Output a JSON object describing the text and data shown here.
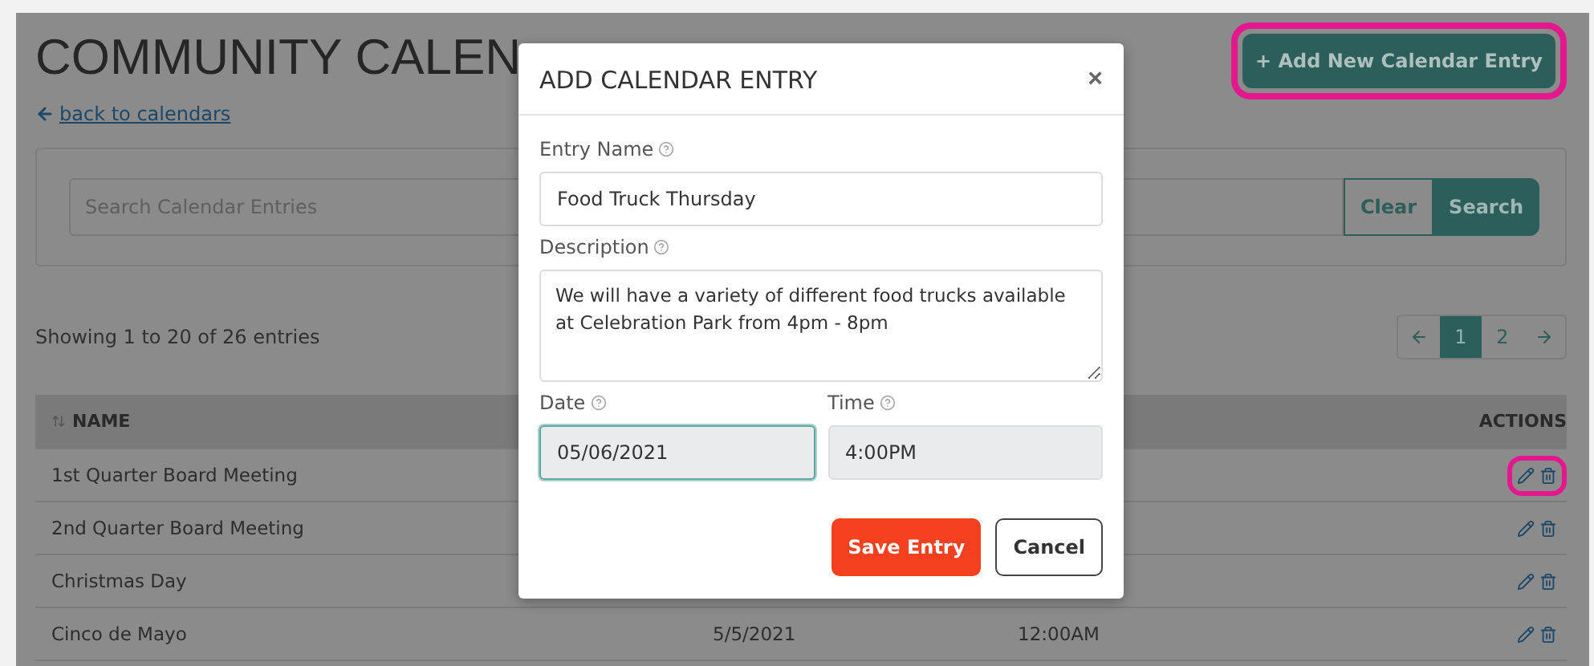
{
  "page": {
    "title": "COMMUNITY CALEN",
    "back_link": "back to calendars",
    "add_button": {
      "label": "+ Add New Calendar Entry",
      "highlighted": true
    }
  },
  "search": {
    "placeholder": "Search Calendar Entries",
    "buttons": [
      {
        "label": "Clear",
        "kind": "outline"
      },
      {
        "label": "Search",
        "kind": "filled"
      }
    ]
  },
  "summary": "Showing 1 to 20 of 26 entries",
  "pagination": {
    "pages": [
      {
        "label": "1",
        "selected": true
      },
      {
        "label": "2",
        "selected": false
      }
    ]
  },
  "table": {
    "columns": [
      {
        "label": "NAME",
        "kind": "sortable"
      },
      {
        "label": "ACTIONS",
        "kind": "plain"
      }
    ],
    "rows": [
      {
        "name": "1st Quarter Board Meeting",
        "actions_highlighted": true
      },
      {
        "name": "2nd Quarter Board Meeting",
        "actions_highlighted": false
      },
      {
        "name": "Christmas Day",
        "actions_highlighted": false
      },
      {
        "name": "Cinco de Mayo",
        "date": "5/5/2021",
        "time": "12:00AM",
        "actions_highlighted": false
      }
    ]
  },
  "modal": {
    "title": "ADD CALENDAR ENTRY",
    "close": "×",
    "fields": [
      {
        "label": "Entry Name",
        "value": "Food Truck Thursday",
        "kind": "text",
        "focused": false
      },
      {
        "label": "Description",
        "value": "We will have a variety of different food trucks available at Celebration Park from 4pm - 8pm",
        "kind": "textarea",
        "focused": false
      }
    ],
    "pair": [
      {
        "label": "Date",
        "value": "05/06/2021",
        "focused": true
      },
      {
        "label": "Time",
        "value": "4:00PM",
        "focused": false
      }
    ],
    "buttons": [
      {
        "label": "Save Entry",
        "kind": "primary"
      },
      {
        "label": "Cancel",
        "kind": "secondary"
      }
    ]
  }
}
